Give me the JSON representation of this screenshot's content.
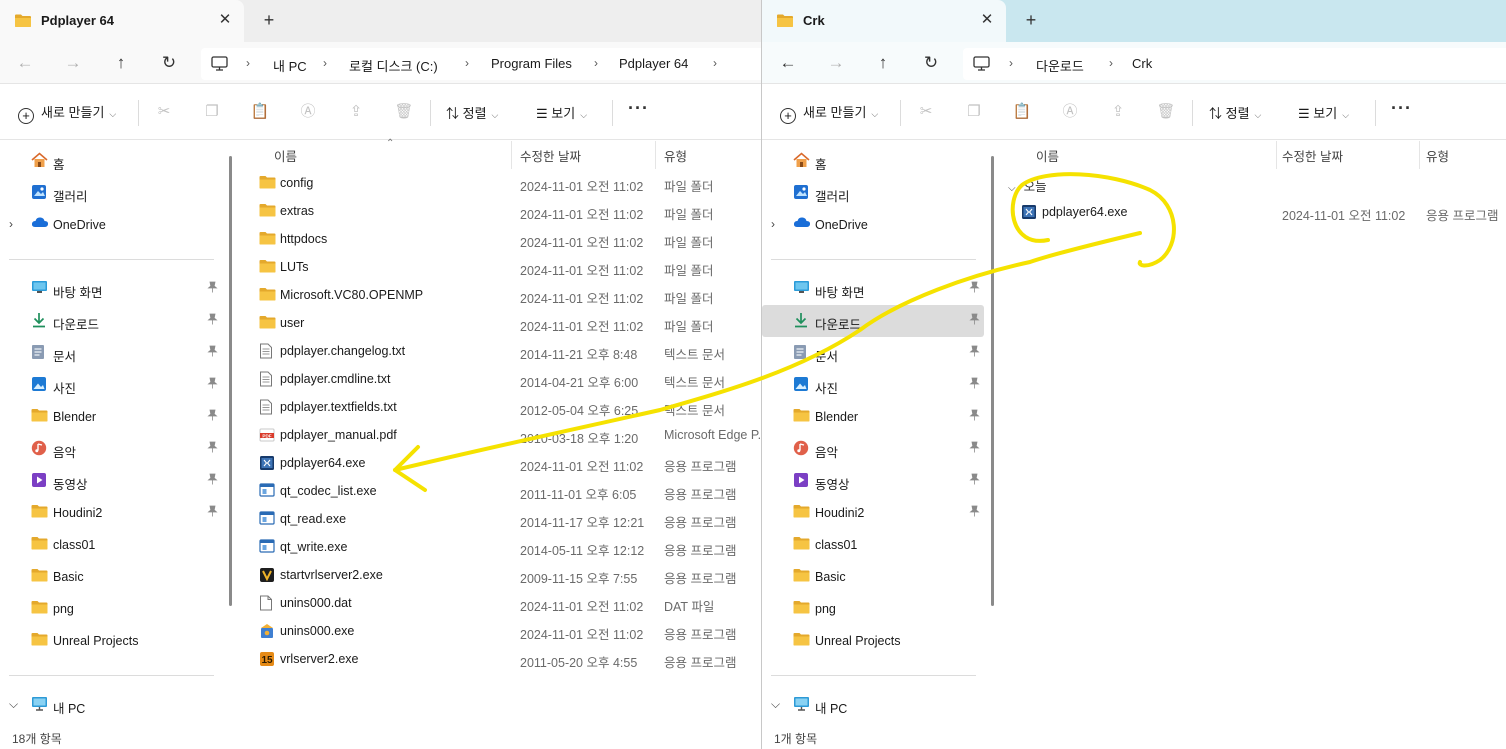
{
  "left_window": {
    "tab_title": "Pdplayer 64",
    "tab_close": "✕",
    "new_tab": "+",
    "breadcrumb": [
      "내 PC",
      "로컬 디스크 (C:)",
      "Program Files",
      "Pdplayer 64"
    ],
    "toolbar": {
      "new_label": "새로 만들기",
      "sort_label": "정렬",
      "view_label": "보기",
      "more_label": "···"
    },
    "columns": {
      "name": "이름",
      "date": "수정한 날짜",
      "type": "유형"
    },
    "sidebar": {
      "top": [
        {
          "label": "홈",
          "icon": "home-icon"
        },
        {
          "label": "갤러리",
          "icon": "gallery-icon"
        },
        {
          "label": "OneDrive",
          "icon": "cloud-icon"
        }
      ],
      "pinned": [
        {
          "label": "바탕 화면",
          "icon": "desktop-icon"
        },
        {
          "label": "다운로드",
          "icon": "download-icon"
        },
        {
          "label": "문서",
          "icon": "document-icon"
        },
        {
          "label": "사진",
          "icon": "picture-icon"
        },
        {
          "label": "Blender",
          "icon": "folder-icon"
        },
        {
          "label": "음악",
          "icon": "music-icon"
        },
        {
          "label": "동영상",
          "icon": "video-icon"
        },
        {
          "label": "Houdini2",
          "icon": "folder-icon"
        },
        {
          "label": "class01",
          "icon": "folder-icon"
        },
        {
          "label": "Basic",
          "icon": "folder-icon"
        },
        {
          "label": "png",
          "icon": "folder-icon"
        },
        {
          "label": "Unreal Projects",
          "icon": "folder-icon"
        }
      ],
      "this_pc": "내 PC"
    },
    "files": [
      {
        "name": "config",
        "date": "2024-11-01 오전 11:02",
        "type": "파일 폴더",
        "icon": "folder-icon"
      },
      {
        "name": "extras",
        "date": "2024-11-01 오전 11:02",
        "type": "파일 폴더",
        "icon": "folder-icon"
      },
      {
        "name": "httpdocs",
        "date": "2024-11-01 오전 11:02",
        "type": "파일 폴더",
        "icon": "folder-icon"
      },
      {
        "name": "LUTs",
        "date": "2024-11-01 오전 11:02",
        "type": "파일 폴더",
        "icon": "folder-icon"
      },
      {
        "name": "Microsoft.VC80.OPENMP",
        "date": "2024-11-01 오전 11:02",
        "type": "파일 폴더",
        "icon": "folder-icon"
      },
      {
        "name": "user",
        "date": "2024-11-01 오전 11:02",
        "type": "파일 폴더",
        "icon": "folder-icon"
      },
      {
        "name": "pdplayer.changelog.txt",
        "date": "2014-11-21 오후 8:48",
        "type": "텍스트 문서",
        "icon": "text-file-icon"
      },
      {
        "name": "pdplayer.cmdline.txt",
        "date": "2014-04-21 오후 6:00",
        "type": "텍스트 문서",
        "icon": "text-file-icon"
      },
      {
        "name": "pdplayer.textfields.txt",
        "date": "2012-05-04 오후 6:25",
        "type": "텍스트 문서",
        "icon": "text-file-icon"
      },
      {
        "name": "pdplayer_manual.pdf",
        "date": "2010-03-18 오후 1:20",
        "type": "Microsoft Edge P...",
        "icon": "pdf-icon"
      },
      {
        "name": "pdplayer64.exe",
        "date": "2024-11-01 오전 11:02",
        "type": "응용 프로그램",
        "icon": "pdplayer-app-icon"
      },
      {
        "name": "qt_codec_list.exe",
        "date": "2011-11-01 오후 6:05",
        "type": "응용 프로그램",
        "icon": "app-window-icon"
      },
      {
        "name": "qt_read.exe",
        "date": "2014-11-17 오후 12:21",
        "type": "응용 프로그램",
        "icon": "app-window-icon"
      },
      {
        "name": "qt_write.exe",
        "date": "2014-05-11 오후 12:12",
        "type": "응용 프로그램",
        "icon": "app-window-icon"
      },
      {
        "name": "startvrlserver2.exe",
        "date": "2009-11-15 오후 7:55",
        "type": "응용 프로그램",
        "icon": "vrl-server-icon"
      },
      {
        "name": "unins000.dat",
        "date": "2024-11-01 오전 11:02",
        "type": "DAT 파일",
        "icon": "blank-file-icon"
      },
      {
        "name": "unins000.exe",
        "date": "2024-11-01 오전 11:02",
        "type": "응용 프로그램",
        "icon": "installer-icon"
      },
      {
        "name": "vrlserver2.exe",
        "date": "2011-05-20 오후 4:55",
        "type": "응용 프로그램",
        "icon": "vrl-icon"
      }
    ],
    "status": "18개 항목"
  },
  "right_window": {
    "tab_title": "Crk",
    "tab_close": "✕",
    "new_tab": "+",
    "breadcrumb": [
      "다운로드",
      "Crk"
    ],
    "toolbar": {
      "new_label": "새로 만들기",
      "sort_label": "정렬",
      "view_label": "보기",
      "more_label": "···"
    },
    "columns": {
      "name": "이름",
      "date": "수정한 날짜",
      "type": "유형"
    },
    "group_label": "오늘",
    "sidebar": {
      "top": [
        {
          "label": "홈",
          "icon": "home-icon"
        },
        {
          "label": "갤러리",
          "icon": "gallery-icon"
        },
        {
          "label": "OneDrive",
          "icon": "cloud-icon"
        }
      ],
      "pinned": [
        {
          "label": "바탕 화면",
          "icon": "desktop-icon"
        },
        {
          "label": "다운로드",
          "icon": "download-icon"
        },
        {
          "label": "문서",
          "icon": "document-icon"
        },
        {
          "label": "사진",
          "icon": "picture-icon"
        },
        {
          "label": "Blender",
          "icon": "folder-icon"
        },
        {
          "label": "음악",
          "icon": "music-icon"
        },
        {
          "label": "동영상",
          "icon": "video-icon"
        },
        {
          "label": "Houdini2",
          "icon": "folder-icon"
        },
        {
          "label": "class01",
          "icon": "folder-icon"
        },
        {
          "label": "Basic",
          "icon": "folder-icon"
        },
        {
          "label": "png",
          "icon": "folder-icon"
        },
        {
          "label": "Unreal Projects",
          "icon": "folder-icon"
        }
      ],
      "this_pc": "내 PC"
    },
    "files": [
      {
        "name": "pdplayer64.exe",
        "date": "2024-11-01 오전 11:02",
        "type": "응용 프로그램",
        "icon": "pdplayer-app-icon"
      }
    ],
    "status": "1개 항목"
  },
  "annotation": {
    "color": "#f5e200",
    "shape": "circled file with arrow pointing to left window file"
  },
  "colors": {
    "folder": "#f6c443",
    "folder_dark": "#e4a92c",
    "accent_blue": "#1e6fd6",
    "selected_nav": "#dcdcdc"
  }
}
